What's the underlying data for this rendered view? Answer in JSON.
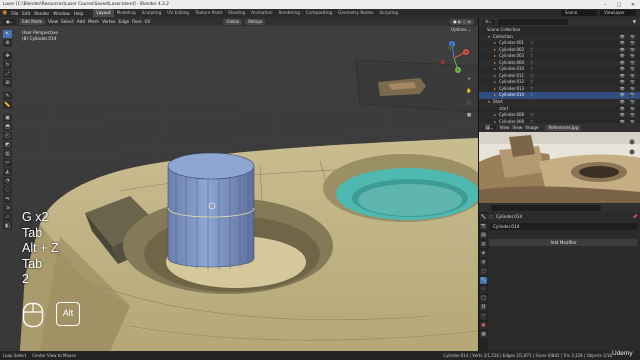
{
  "window": {
    "title": "Laser [C:\\Blender\\Resources\\Laser Course\\Saved\\Laser.blend] - Blender 4.3.2",
    "buttons": [
      "–",
      "□",
      "✕"
    ]
  },
  "top_menu": {
    "items": [
      "File",
      "Edit",
      "Render",
      "Window",
      "Help"
    ],
    "workspaces": [
      "Layout",
      "Modeling",
      "Sculpting",
      "UV Editing",
      "Texture Paint",
      "Shading",
      "Animation",
      "Rendering",
      "Compositing",
      "Geometry Nodes",
      "Scripting"
    ],
    "active_workspace": "Layout",
    "scene": "Scene",
    "view_layer": "ViewLayer"
  },
  "viewport_header": {
    "mode": "Edit Mode",
    "menus": [
      "View",
      "Select",
      "Add",
      "Mesh",
      "Vertex",
      "Edge",
      "Face",
      "UV"
    ],
    "transform_orientation": "Global",
    "pivot": "Retopo",
    "snap": "Retopoflow"
  },
  "viewport": {
    "view_name": "User Perspective",
    "object_info": "(8) Cylinder.014",
    "options_label": "Options ⌄",
    "gizmo": {
      "x": "X",
      "y": "Y",
      "z": "Z"
    },
    "nav_buttons": [
      "+",
      "✋",
      "🎥",
      "▦"
    ]
  },
  "key_overlay": {
    "lines": [
      "G x2",
      "Tab",
      "Alt + Z",
      "Tab",
      "2"
    ],
    "alt_key": "Alt"
  },
  "outliner": {
    "rows": [
      {
        "label": "Scene Collection",
        "indent": 0,
        "tri": ""
      },
      {
        "label": "Collection",
        "indent": 1,
        "tri": "▾"
      },
      {
        "label": "Cylinder.001",
        "indent": 2,
        "tri": "▸"
      },
      {
        "label": "Cylinder.002",
        "indent": 2,
        "tri": "▸"
      },
      {
        "label": "Cylinder.003",
        "indent": 2,
        "tri": "▸"
      },
      {
        "label": "Cylinder.004",
        "indent": 2,
        "tri": "▸"
      },
      {
        "label": "Cylinder.010",
        "indent": 2,
        "tri": "▸"
      },
      {
        "label": "Cylinder.011",
        "indent": 2,
        "tri": "▸"
      },
      {
        "label": "Cylinder.012",
        "indent": 2,
        "tri": "▸"
      },
      {
        "label": "Cylinder.013",
        "indent": 2,
        "tri": "▸"
      },
      {
        "label": "Cylinder.014",
        "indent": 2,
        "tri": "▸",
        "selected": true
      },
      {
        "label": "Start",
        "indent": 1,
        "tri": "▾"
      },
      {
        "label": "start",
        "indent": 2,
        "tri": ""
      },
      {
        "label": "Cylinder.008",
        "indent": 2,
        "tri": "▸"
      },
      {
        "label": "Cylinder.009",
        "indent": 2,
        "tri": "▸"
      }
    ]
  },
  "image_editor": {
    "menus": [
      "View",
      "View",
      "Image"
    ],
    "image_name": "References.jpg"
  },
  "properties": {
    "object_name": "Cylinder.014",
    "modifier_field": "Cylinder.014",
    "add_modifier_label": "Add Modifier"
  },
  "statusbar": {
    "left_items": [
      "Loop Select",
      "Center View to Mouse"
    ],
    "stats": "Cylinder.014 | Verts 2/1,516 | Edges 2/2,871 | Faces 0/842 | Tris 3,128 | Objects 1/16",
    "watermark": "Udemy"
  },
  "colors": {
    "accent": "#4772b3",
    "model_tan": "#c2b486",
    "model_blue": "#7d95c4",
    "teal": "#4fb8b0"
  }
}
